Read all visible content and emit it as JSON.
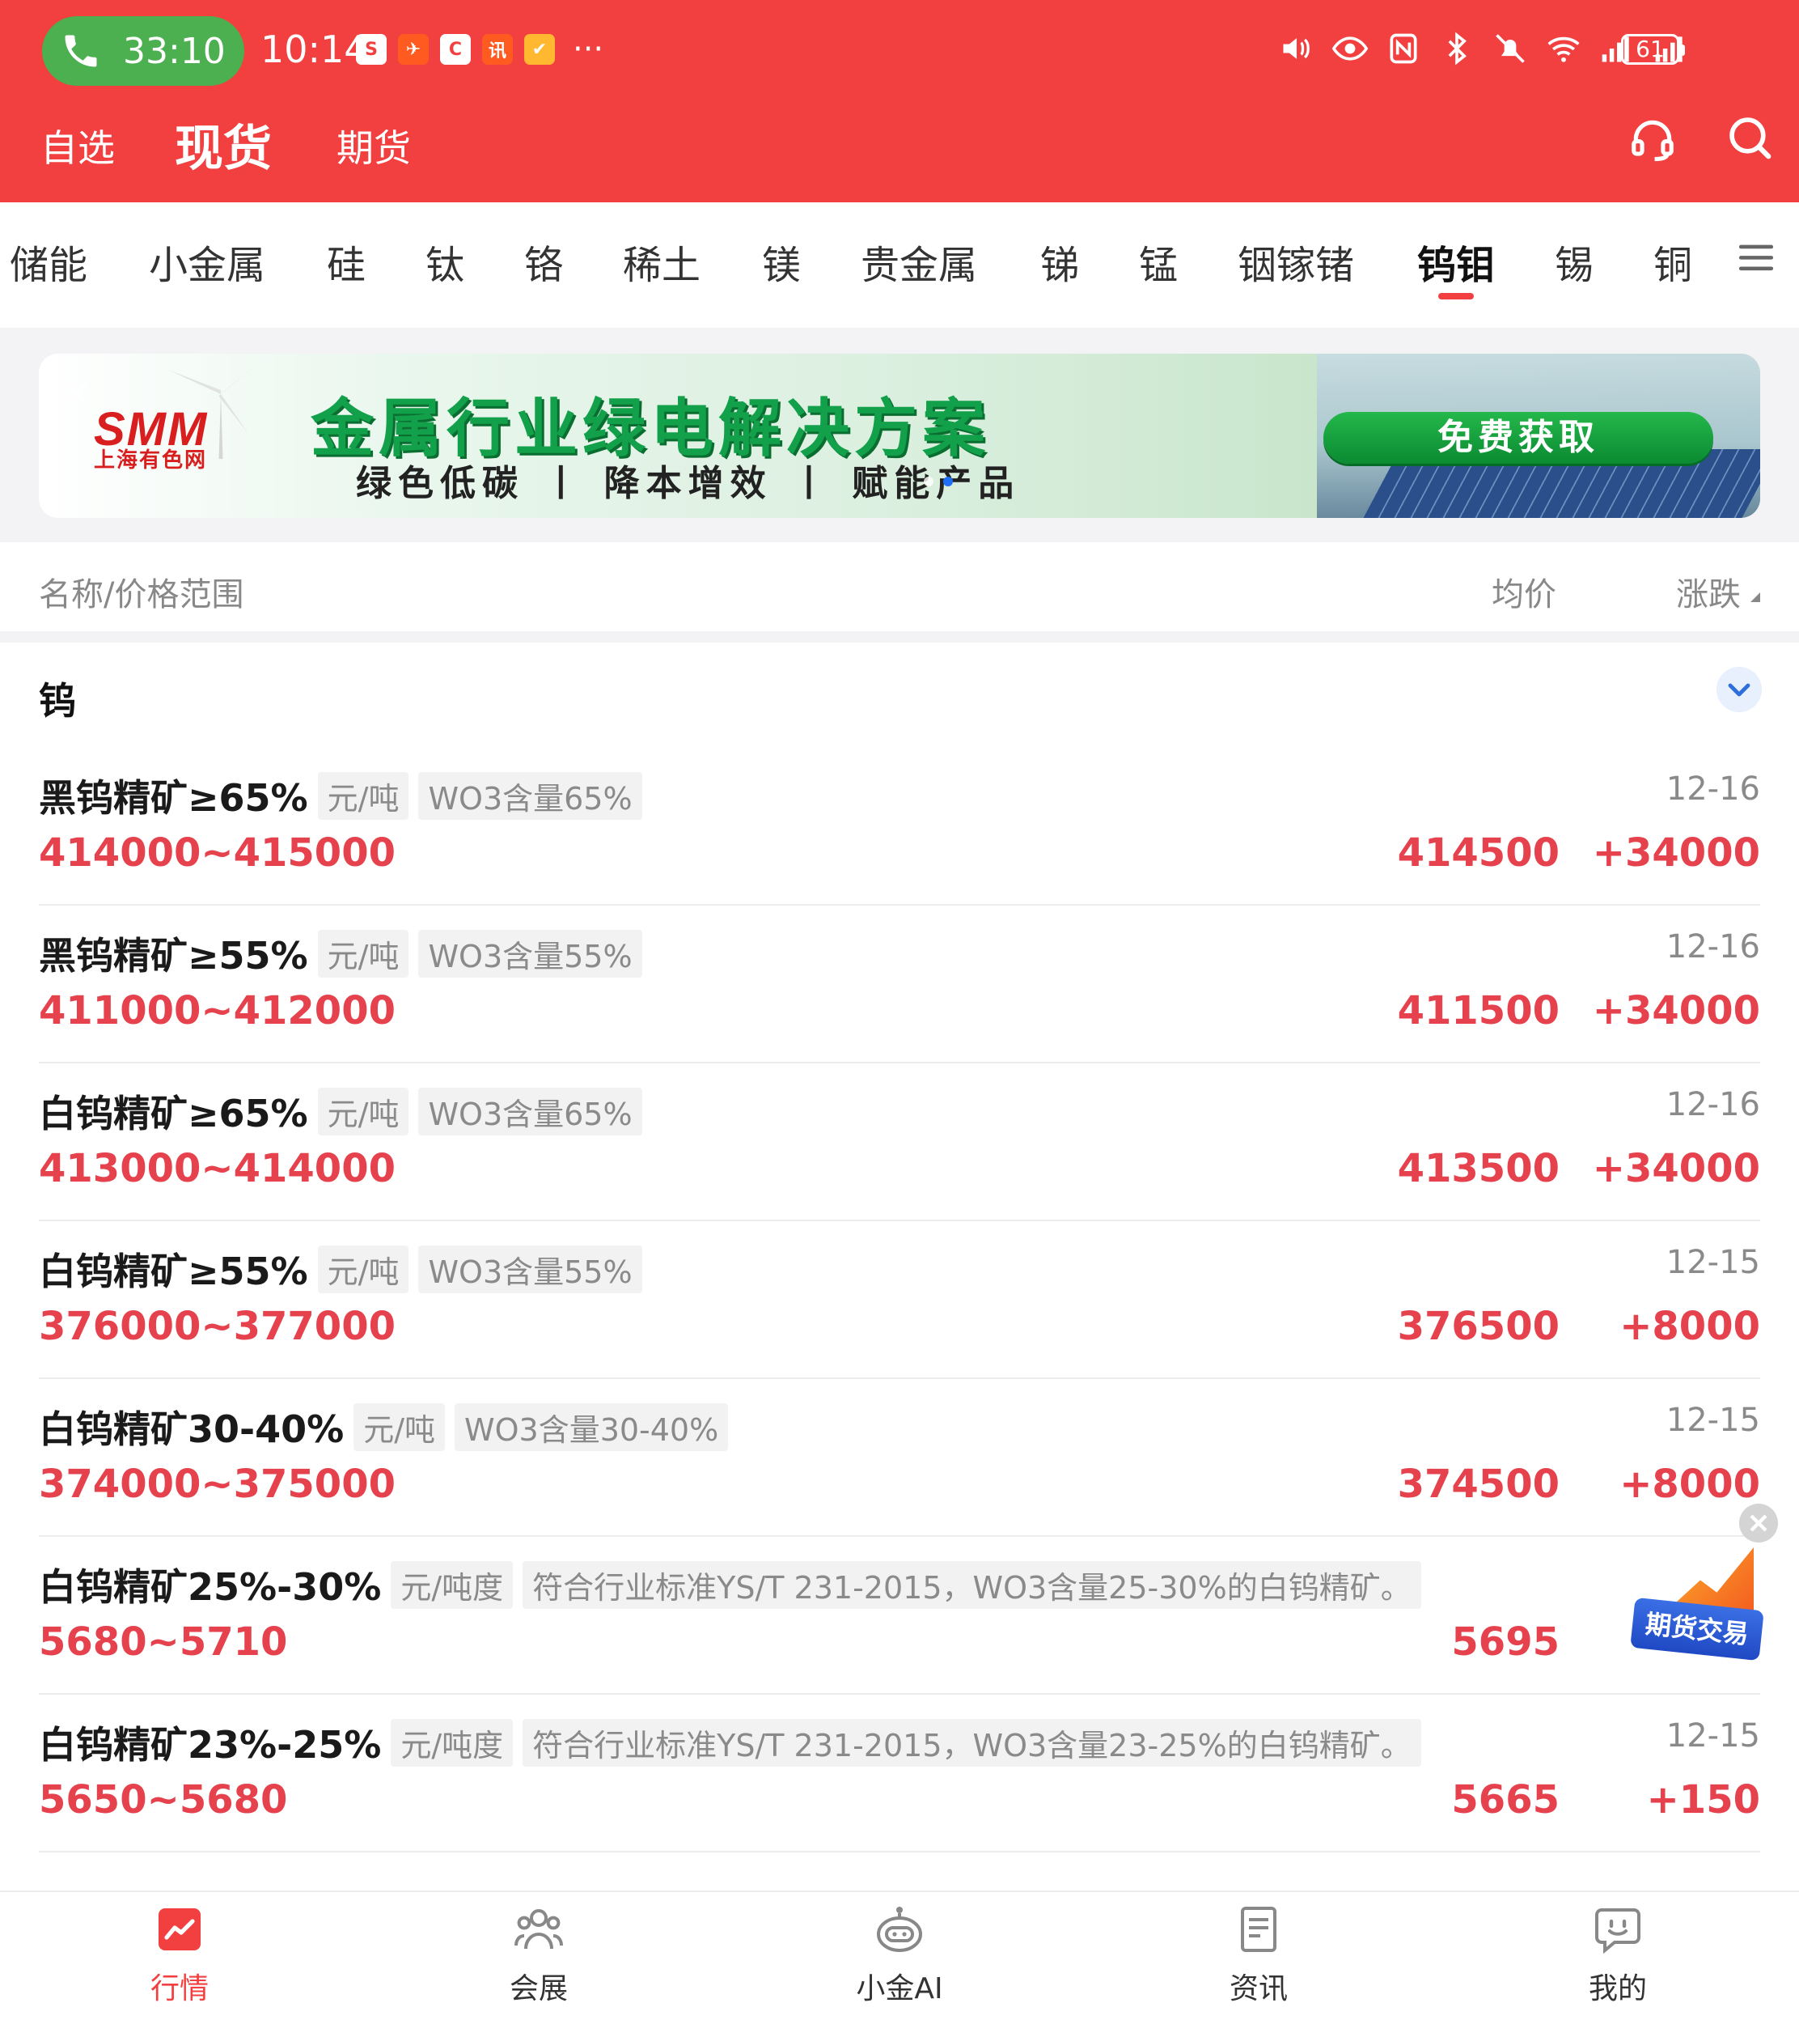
{
  "status_bar": {
    "call_time": "33:10",
    "time": "10:14",
    "notification_icons": [
      "sina-icon",
      "telegram-icon",
      "c-app-icon",
      "news-app-icon",
      "orange-app-icon"
    ],
    "notif_glyphs": [
      "S",
      "✈",
      "C",
      "讯",
      "✔"
    ],
    "more": "···",
    "battery": "61"
  },
  "top_tabs": [
    {
      "label": "自选"
    },
    {
      "label": "现货"
    },
    {
      "label": "期货"
    }
  ],
  "categories": [
    "储能",
    "小金属",
    "硅",
    "钛",
    "铬",
    "稀土",
    "镁",
    "贵金属",
    "锑",
    "锰",
    "铟镓锗",
    "钨钼",
    "锡",
    "铜"
  ],
  "active_category": "钨钼",
  "banner": {
    "logo_main": "SMM",
    "logo_sub": "上海有色网",
    "title": "金属行业绿电解决方案",
    "subtitle": "绿色低碳 丨 降本增效 丨 赋能产品",
    "cta": "免费获取"
  },
  "list_header": {
    "name": "名称/价格范围",
    "avg": "均价",
    "change": "涨跌"
  },
  "section": {
    "title": "钨"
  },
  "items": [
    {
      "name": "黑钨精矿≥65%",
      "unit": "元/吨",
      "spec": "WO3含量65%",
      "date": "12-16",
      "range": "414000~415000",
      "avg": "414500",
      "change": "+34000"
    },
    {
      "name": "黑钨精矿≥55%",
      "unit": "元/吨",
      "spec": "WO3含量55%",
      "date": "12-16",
      "range": "411000~412000",
      "avg": "411500",
      "change": "+34000"
    },
    {
      "name": "白钨精矿≥65%",
      "unit": "元/吨",
      "spec": "WO3含量65%",
      "date": "12-16",
      "range": "413000~414000",
      "avg": "413500",
      "change": "+34000"
    },
    {
      "name": "白钨精矿≥55%",
      "unit": "元/吨",
      "spec": "WO3含量55%",
      "date": "12-15",
      "range": "376000~377000",
      "avg": "376500",
      "change": "+8000"
    },
    {
      "name": "白钨精矿30-40%",
      "unit": "元/吨",
      "spec": "WO3含量30-40%",
      "date": "12-15",
      "range": "374000~375000",
      "avg": "374500",
      "change": "+8000"
    },
    {
      "name": "白钨精矿25%-30%",
      "unit": "元/吨度",
      "spec": "符合行业标准YS/T 231-2015，WO3含量25-30%的白钨精矿。",
      "date": "",
      "range": "5680~5710",
      "avg": "5695",
      "change": ""
    },
    {
      "name": "白钨精矿23%-25%",
      "unit": "元/吨度",
      "spec": "符合行业标准YS/T 231-2015，WO3含量23-25%的白钨精矿。",
      "date": "12-15",
      "range": "5650~5680",
      "avg": "5665",
      "change": "+150"
    }
  ],
  "float_badge": {
    "label": "期货交易"
  },
  "bottom_nav": [
    {
      "label": "行情",
      "icon": "chart-icon"
    },
    {
      "label": "会展",
      "icon": "people-icon"
    },
    {
      "label": "小金AI",
      "icon": "robot-icon"
    },
    {
      "label": "资讯",
      "icon": "document-icon"
    },
    {
      "label": "我的",
      "icon": "profile-icon"
    }
  ],
  "colors": {
    "brand_red": "#f23f3f",
    "price_red": "#e5424d",
    "call_green": "#4caf50",
    "banner_green": "#12a04a"
  }
}
